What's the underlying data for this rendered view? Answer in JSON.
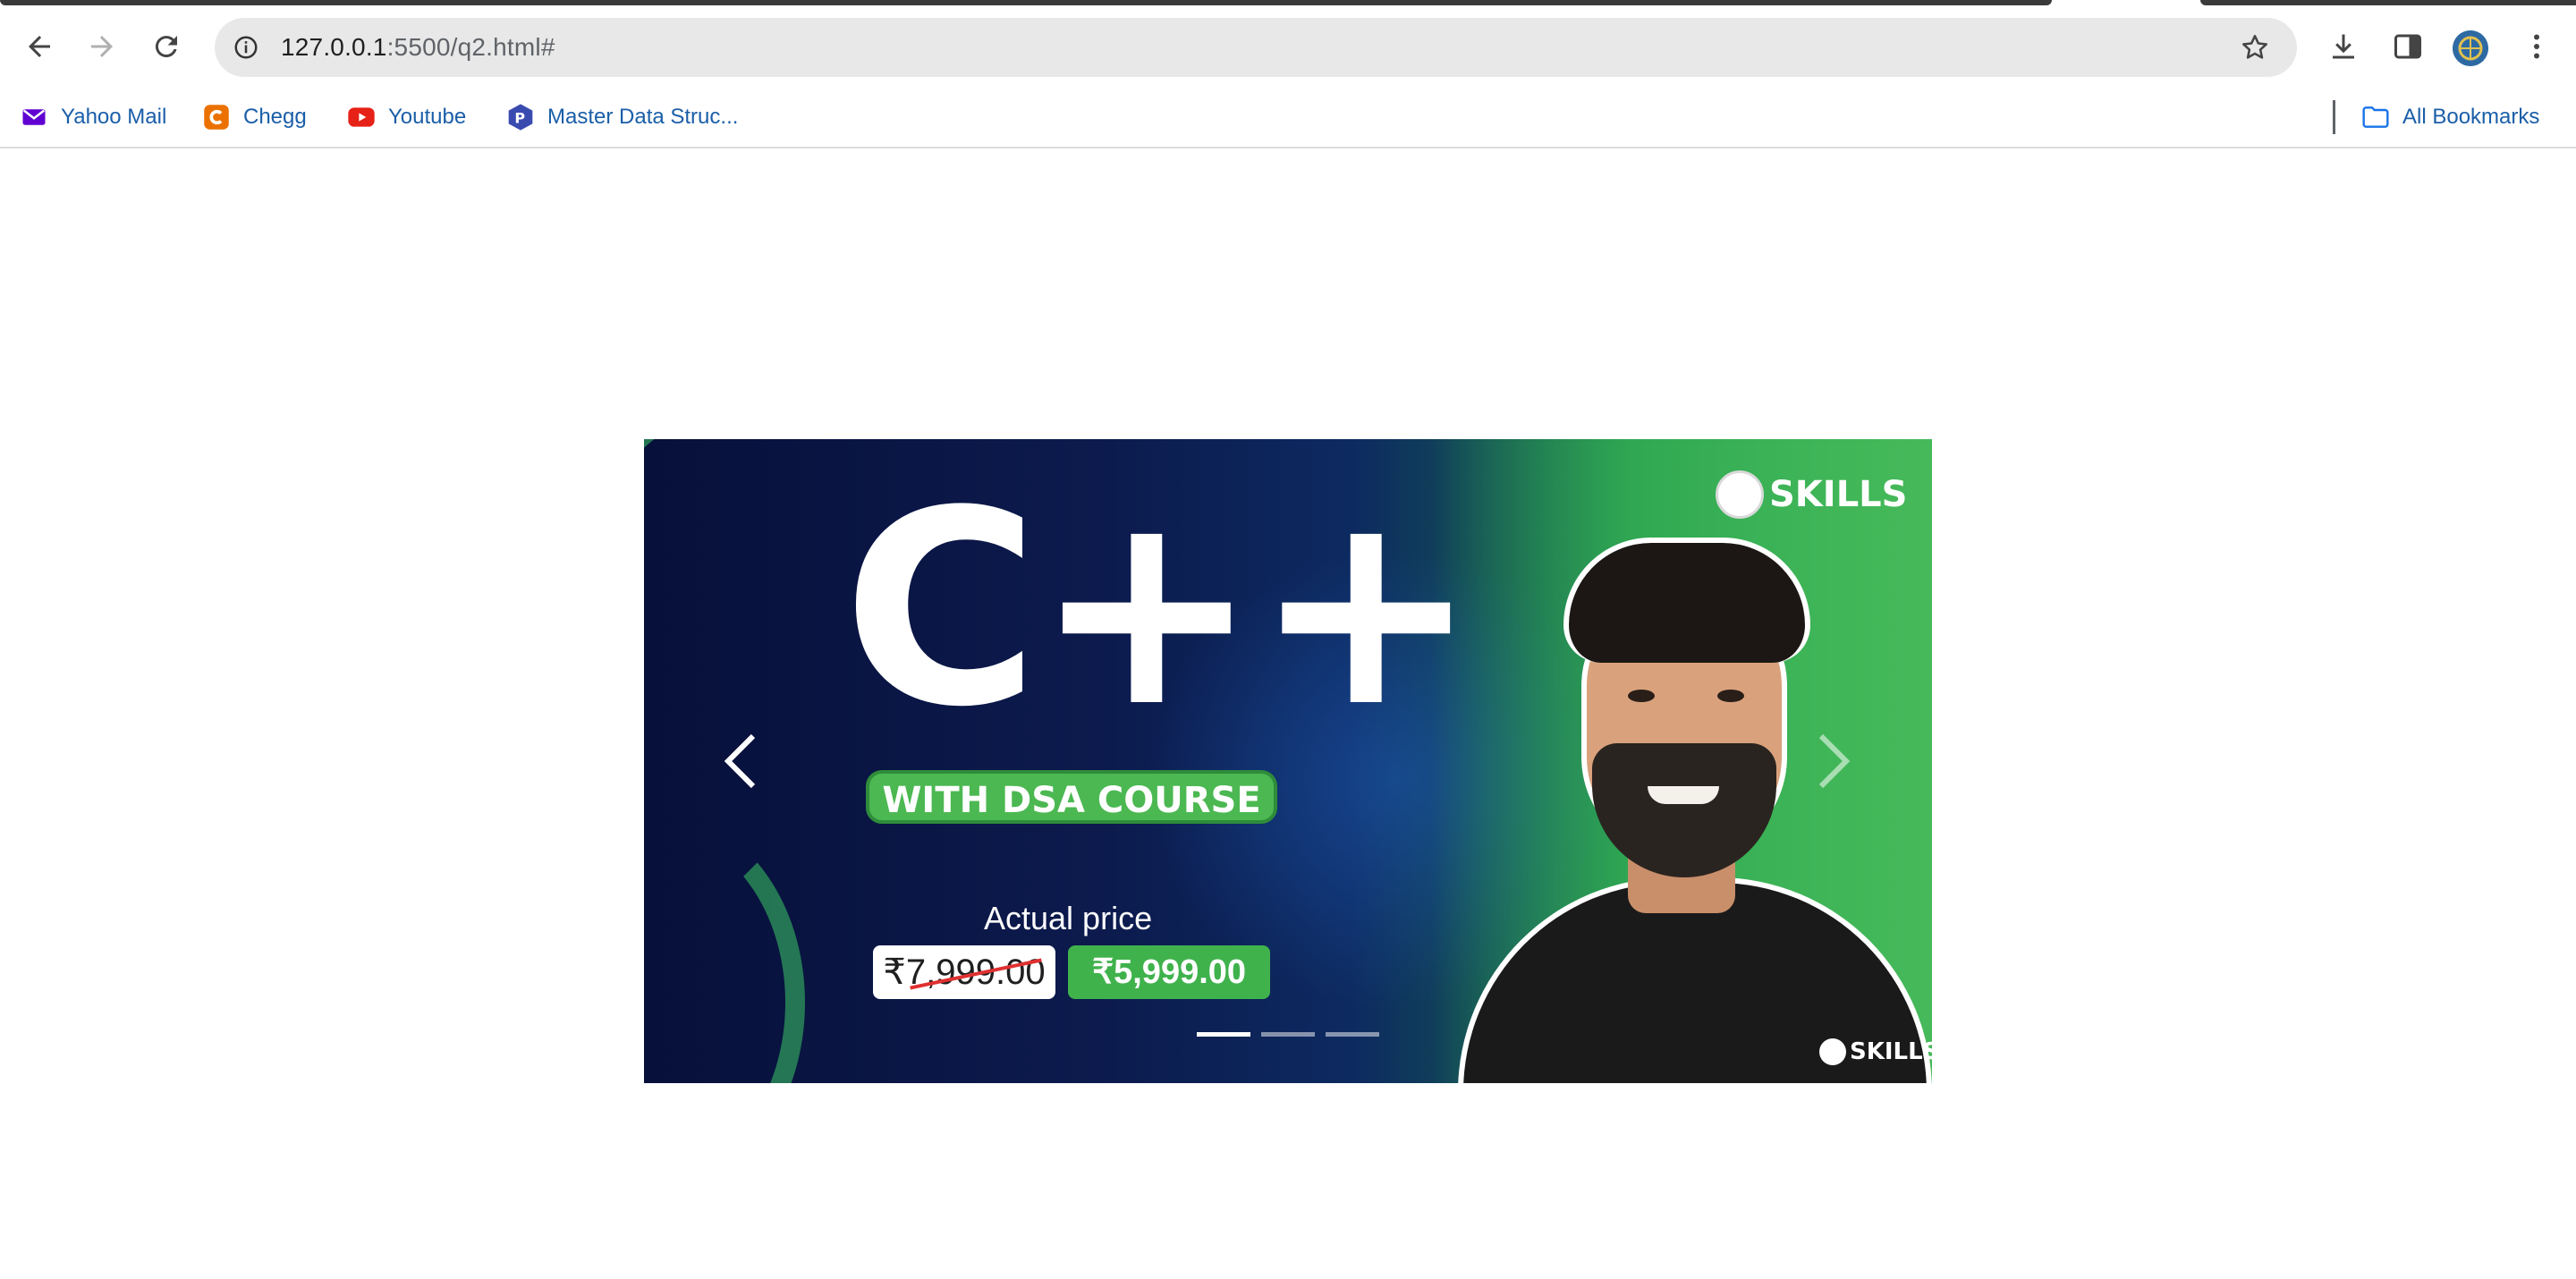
{
  "browser": {
    "url_host": "127.0.0.1",
    "url_path": ":5500/q2.html#"
  },
  "bookmarks": [
    {
      "label": "Yahoo Mail",
      "icon": "mail-icon",
      "color": "#6001d2"
    },
    {
      "label": "Chegg",
      "icon": "chegg-icon",
      "color": "#eb7100"
    },
    {
      "label": "Youtube",
      "icon": "youtube-icon",
      "color": "#e62117"
    },
    {
      "label": "Master Data Struc...",
      "icon": "gfg-icon",
      "color": "#3a4bb0"
    }
  ],
  "all_bookmarks_label": "All Bookmarks",
  "carousel": {
    "headline": "C++",
    "course_label": "WITH DSA COURSE",
    "actual_price_label": "Actual price",
    "old_price": "₹7,999.00",
    "new_price": "₹5,999.00",
    "brand": "SKILLS",
    "brand_small": "SKILLS",
    "slide_count": 3,
    "active_slide": 1
  },
  "colors": {
    "accent_green": "#3fb24c",
    "link_blue": "#1a5ea8"
  }
}
